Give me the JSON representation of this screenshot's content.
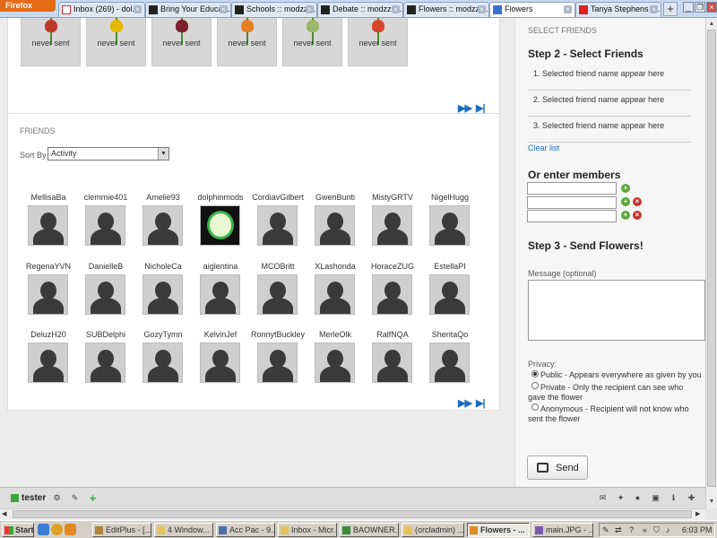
{
  "browser": {
    "app_button": "Firefox",
    "tabs": [
      {
        "label": "Inbox (269) - dol...",
        "icon": "gmail-icon"
      },
      {
        "label": "Bring Your Educat...",
        "icon": "modzzz-icon"
      },
      {
        "label": "Schools :: modzzz'...",
        "icon": "modzzz-icon"
      },
      {
        "label": "Debate :: modzzz'...",
        "icon": "modzzz-icon"
      },
      {
        "label": "Flowers :: modzzz...",
        "icon": "modzzz-icon"
      },
      {
        "label": "Flowers",
        "icon": "site-icon",
        "active": true
      },
      {
        "label": "Tanya Stephens - ...",
        "icon": "youtube-icon"
      }
    ],
    "new_tab": "+"
  },
  "flowers": {
    "items": [
      {
        "status": "never sent",
        "color": "#c0392b"
      },
      {
        "status": "never sent",
        "color": "#e6b800"
      },
      {
        "status": "never sent",
        "color": "#7a1f2b"
      },
      {
        "status": "never sent",
        "color": "#e67e22"
      },
      {
        "status": "never sent",
        "color": "#9bb86a"
      },
      {
        "status": "never sent",
        "color": "#d9472b"
      }
    ]
  },
  "friends": {
    "section_title": "FRIENDS",
    "sort_label": "Sort By",
    "sort_value": "Activity",
    "rows": [
      [
        "MellisaBa",
        "clemmie401",
        "Amelie93",
        "dolphinmods",
        "CordiavGilbert",
        "GwenBunti",
        "MistyGRTV",
        "NigelHugg"
      ],
      [
        "RegenaYVN",
        "DanielleB",
        "NicholeCa",
        "aiglentina",
        "MCOBritt",
        "XLashonda",
        "HoraceZUG",
        "EstellaPI"
      ],
      [
        "DeluzH20",
        "SUBDelphi",
        "GozyTymn",
        "KelvinJef",
        "RonnytBuckley",
        "MerleOlk",
        "RalfNQA",
        "SheritaQo"
      ]
    ]
  },
  "sidebar": {
    "select_friends_caption": "SELECT FRIENDS",
    "step2_title": "Step 2 - Select Friends",
    "selected_slots": [
      "1. Selected friend name appear here",
      "2. Selected friend name appear here",
      "3. Selected friend name appear here"
    ],
    "clear_list": "Clear list",
    "or_enter_members": "Or enter members",
    "step3_title": "Step 3 - Send Flowers!",
    "message_label": "Message (optional)",
    "privacy_label": "Privacy:",
    "privacy_options": [
      {
        "line1": "Public - Appears everywhere as given by you",
        "line2": "",
        "checked": true
      },
      {
        "line1": "Private - Only the recipient can see who",
        "line2": "gave the flower",
        "checked": false
      },
      {
        "line1": "Anonymous - Recipient will not know who",
        "line2": "sent the flower",
        "checked": false
      }
    ],
    "send_button": "Send"
  },
  "bottombar": {
    "user": "tester"
  },
  "taskbar": {
    "start": "Start",
    "items": [
      {
        "label": "EditPlus - [..."
      },
      {
        "label": "4 Window..."
      },
      {
        "label": "Acc Pac - 9..."
      },
      {
        "label": "Inbox - Micr..."
      },
      {
        "label": "BAOWNER..."
      },
      {
        "label": "(orcladmin) ..."
      },
      {
        "label": "Flowers - ...",
        "active": true
      },
      {
        "label": "main.JPG - ..."
      }
    ],
    "clock": "6:03 PM"
  }
}
